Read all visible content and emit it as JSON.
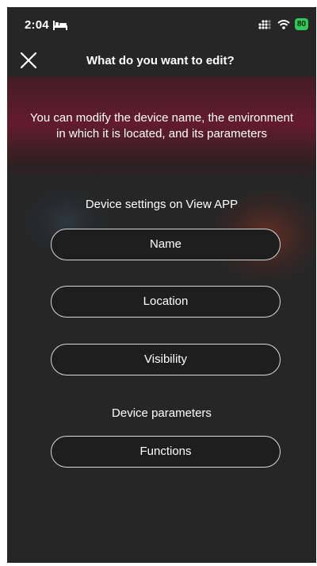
{
  "status_bar": {
    "time": "2:04",
    "battery": "80"
  },
  "header": {
    "title": "What do you want to edit?"
  },
  "intro": {
    "line1": "You can modify the device name, the environment",
    "line2": "in which it is located, and its parameters"
  },
  "sections": {
    "view_app": {
      "title": "Device settings on View APP",
      "buttons": [
        "Name",
        "Location",
        "Visibility"
      ]
    },
    "parameters": {
      "title": "Device parameters",
      "buttons": [
        "Functions"
      ]
    }
  },
  "colors": {
    "background": "#262626",
    "accent_glow": "#78192d",
    "button_border": "#d9d9d9",
    "battery": "#34c759"
  },
  "icons": [
    "bed-icon",
    "signal-icon",
    "wifi-icon",
    "battery-icon",
    "close-icon"
  ]
}
